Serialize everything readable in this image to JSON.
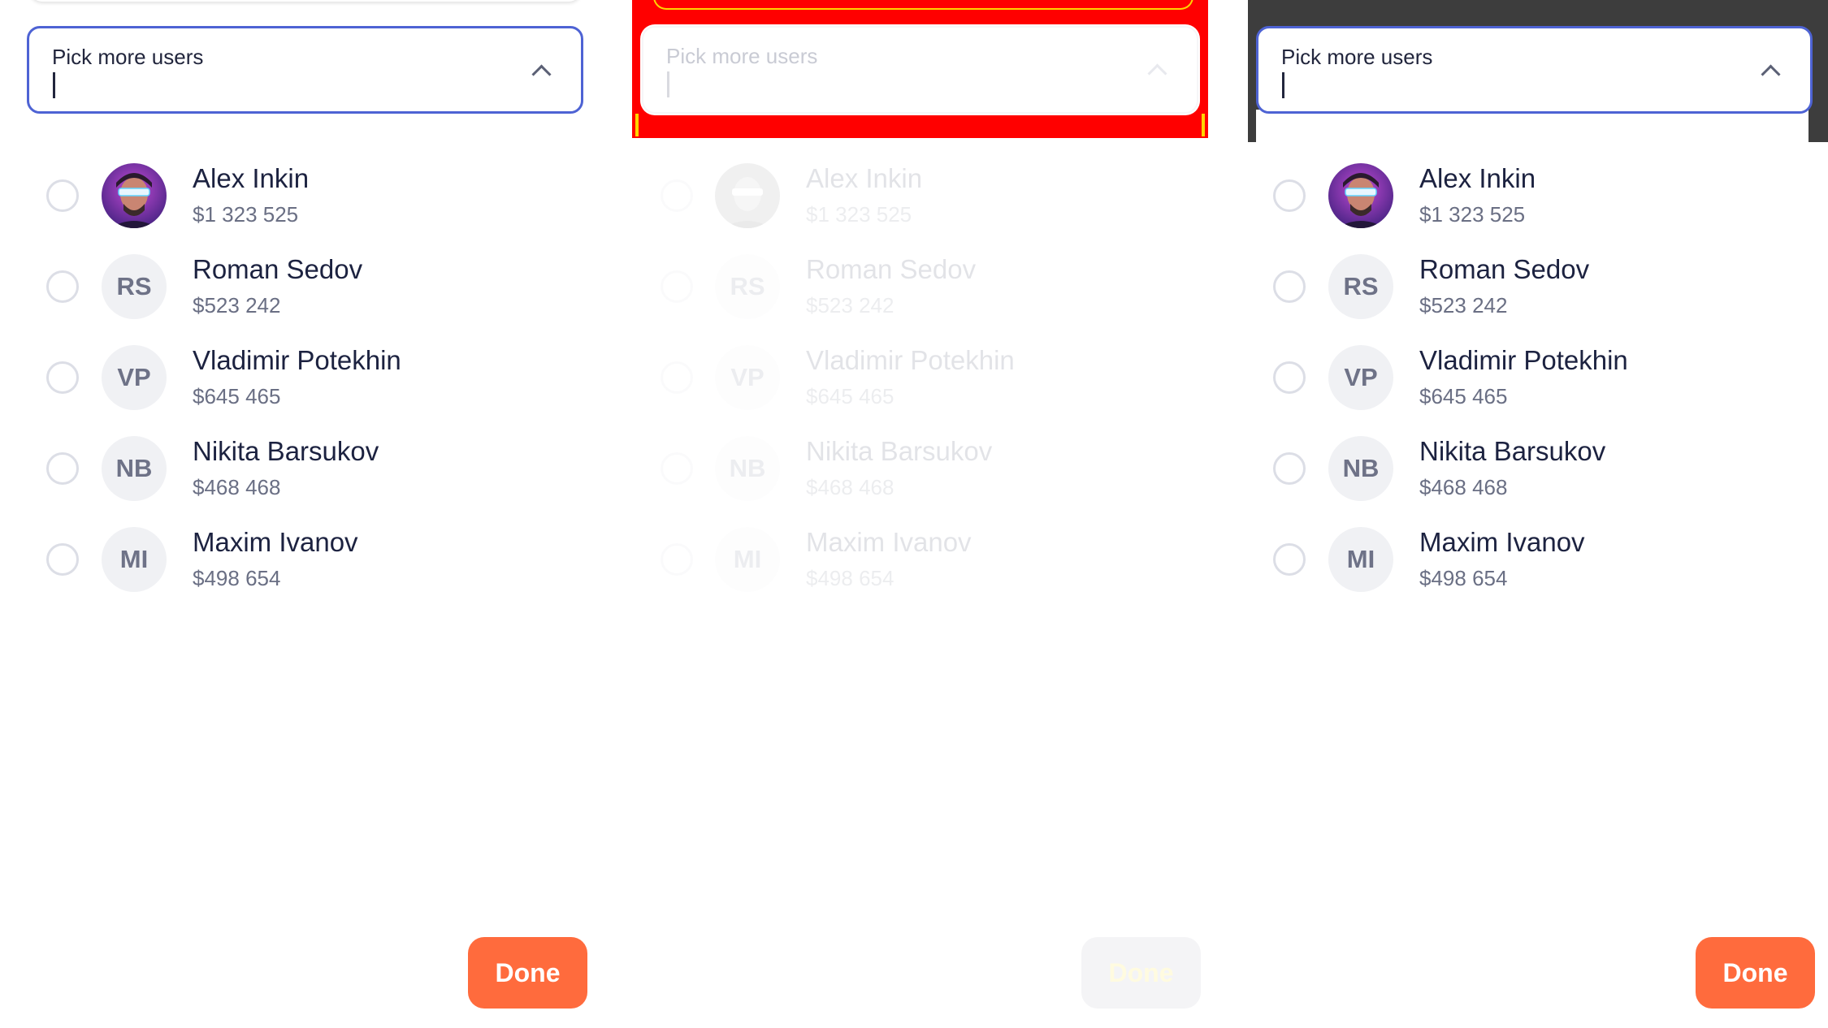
{
  "select": {
    "label": "Pick more users"
  },
  "users": [
    {
      "name": "Alex Inkin",
      "amount": "$1 323 525",
      "initials": "",
      "has_photo": true
    },
    {
      "name": "Roman Sedov",
      "amount": "$523 242",
      "initials": "RS",
      "has_photo": false
    },
    {
      "name": "Vladimir Potekhin",
      "amount": "$645 465",
      "initials": "VP",
      "has_photo": false
    },
    {
      "name": "Nikita Barsukov",
      "amount": "$468 468",
      "initials": "NB",
      "has_photo": false
    },
    {
      "name": "Maxim Ivanov",
      "amount": "$498 654",
      "initials": "MI",
      "has_photo": false
    }
  ],
  "done_label": "Done",
  "colors": {
    "accent": "#ff6b3d",
    "focus_border": "#4e63d4",
    "panel2_background": "#ff0000",
    "panel3_background": "#3d3d3d"
  },
  "icons": {
    "chevron": "chevron-up-icon",
    "radio": "radio-unchecked-icon"
  }
}
